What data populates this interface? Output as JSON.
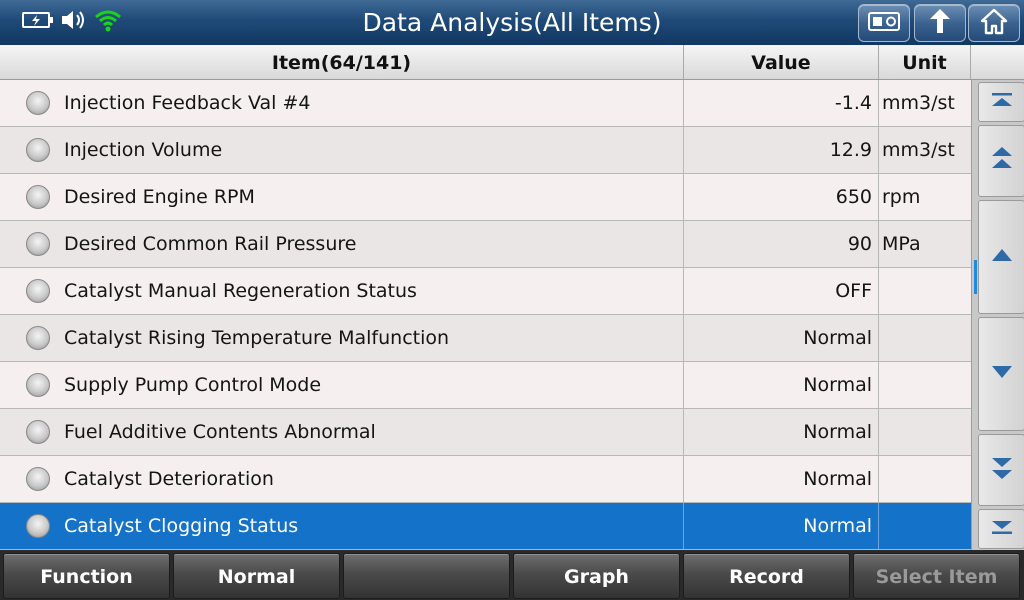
{
  "header": {
    "title": "Data Analysis(All Items)",
    "status_icons": [
      "battery-icon",
      "speaker-icon",
      "wifi-icon"
    ],
    "buttons": [
      "screenshot-icon",
      "back-arrow-icon",
      "home-icon"
    ]
  },
  "table": {
    "columns": {
      "item": "Item(64/141)",
      "value": "Value",
      "unit": "Unit"
    },
    "rows": [
      {
        "name": "Injection Feedback Val #4",
        "value": "-1.4",
        "unit": "mm3/st"
      },
      {
        "name": "Injection Volume",
        "value": "12.9",
        "unit": "mm3/st"
      },
      {
        "name": "Desired Engine RPM",
        "value": "650",
        "unit": "rpm"
      },
      {
        "name": "Desired Common Rail Pressure",
        "value": "90",
        "unit": "MPa"
      },
      {
        "name": "Catalyst Manual Regeneration Status",
        "value": "OFF",
        "unit": ""
      },
      {
        "name": "Catalyst Rising Temperature Malfunction",
        "value": "Normal",
        "unit": ""
      },
      {
        "name": "Supply Pump Control Mode",
        "value": "Normal",
        "unit": ""
      },
      {
        "name": "Fuel Additive Contents Abnormal",
        "value": "Normal",
        "unit": ""
      },
      {
        "name": "Catalyst Deterioration",
        "value": "Normal",
        "unit": ""
      },
      {
        "name": "Catalyst Clogging Status",
        "value": "Normal",
        "unit": ""
      }
    ],
    "selected_row": 9
  },
  "footer": {
    "buttons": [
      {
        "label": "Function",
        "enabled": true
      },
      {
        "label": "Normal",
        "enabled": true
      },
      {
        "label": "",
        "enabled": true
      },
      {
        "label": "Graph",
        "enabled": true
      },
      {
        "label": "Record",
        "enabled": true
      },
      {
        "label": "Select Item",
        "enabled": false
      }
    ]
  },
  "colors": {
    "title_bar": "#1f4a78",
    "selected_row": "#1472c8",
    "disabled_text": "#9a9a9a",
    "wifi": "#19d419"
  }
}
